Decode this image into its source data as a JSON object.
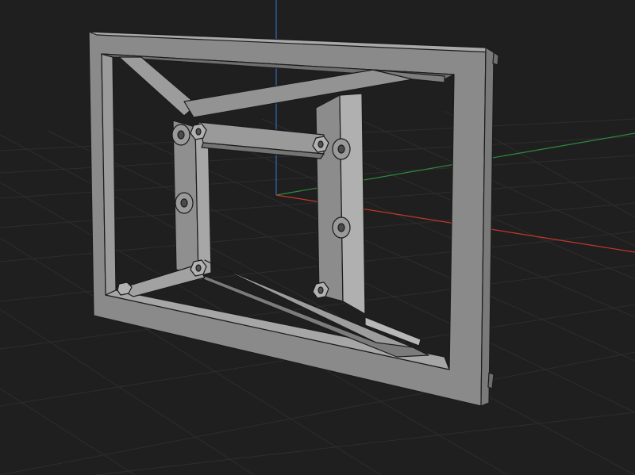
{
  "viewport": {
    "background_color": "#1f1f1f",
    "grid_color": "#2c2c2c",
    "grid_major_color": "#333333"
  },
  "axes": {
    "x": {
      "color": "#c0392b"
    },
    "y": {
      "color": "#2e8b3e"
    },
    "z": {
      "color": "#2e6fbf"
    }
  },
  "model": {
    "face_color": "#8e8e8e",
    "edge_color": "#1a1a1a",
    "fasteners": {
      "washers": 6,
      "hex_nuts": 6
    }
  }
}
